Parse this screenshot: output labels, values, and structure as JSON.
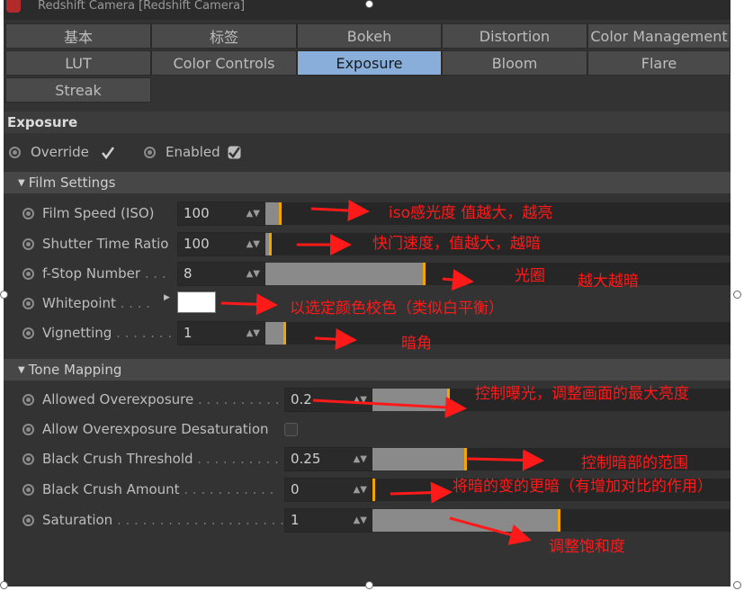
{
  "window": {
    "title": "Redshift Camera [Redshift Camera]"
  },
  "tabs": [
    {
      "label": "基本",
      "active": false
    },
    {
      "label": "标签",
      "active": false
    },
    {
      "label": "Bokeh",
      "active": false
    },
    {
      "label": "Distortion",
      "active": false
    },
    {
      "label": "Color Management",
      "active": false
    },
    {
      "label": "LUT",
      "active": false
    },
    {
      "label": "Color Controls",
      "active": false
    },
    {
      "label": "Exposure",
      "active": true
    },
    {
      "label": "Bloom",
      "active": false
    },
    {
      "label": "Flare",
      "active": false
    },
    {
      "label": "Streak",
      "active": false
    }
  ],
  "section_title": "Exposure",
  "override": {
    "label": "Override",
    "checked": true
  },
  "enabled": {
    "label": "Enabled",
    "checked": true
  },
  "film_settings": {
    "title": "Film Settings",
    "film_speed": {
      "label": "Film Speed (ISO)",
      "value": "100",
      "slider_fraction": 0.03
    },
    "shutter_time": {
      "label": "Shutter Time Ratio",
      "value": "100",
      "slider_fraction": 0.01
    },
    "fstop": {
      "label": "f-Stop Number",
      "dots": " . . .",
      "value": "8",
      "slider_fraction": 0.34
    },
    "whitepoint": {
      "label": "Whitepoint",
      "dots": " . . . .",
      "color": "#ffffff"
    },
    "vignetting": {
      "label": "Vignetting",
      "dots": " . . . . . . .",
      "value": "1",
      "slider_fraction": 0.04
    }
  },
  "tone_mapping": {
    "title": "Tone Mapping",
    "allowed_overexposure": {
      "label": "Allowed Overexposure",
      "dots": " . . . . . . . . . .",
      "value": "0.2",
      "slider_fraction": 0.21
    },
    "desaturation": {
      "label": "Allow Overexposure Desaturation",
      "checked": false
    },
    "black_crush_threshold": {
      "label": "Black Crush Threshold",
      "dots": " . . . . . . . . . .",
      "value": "0.25",
      "slider_fraction": 0.26
    },
    "black_crush_amount": {
      "label": "Black Crush Amount",
      "dots": " . . . . . . . . . . .",
      "value": "0",
      "slider_fraction": 0.0
    },
    "saturation": {
      "label": "Saturation",
      "dots": " . . . . . . . . . . . . . . . . . . . .",
      "value": "1",
      "slider_fraction": 0.52
    }
  },
  "annotations": {
    "iso": "iso感光度 值越大，越亮",
    "shutter": "快门速度，值越大，越暗",
    "fstop_a": "光圈",
    "fstop_b": "越大越暗",
    "whitepoint": "以选定颜色校色（类似白平衡）",
    "vignetting": "暗角",
    "overexposure": "控制曝光，调整画面的最大亮度",
    "threshold": "控制暗部的范围",
    "amount": "将暗的变的更暗（有增加对比的作用）",
    "saturation": "调整饱和度"
  },
  "colors": {
    "accent": "#f0a500",
    "active_tab": "#89aed9",
    "annotation": "#ff1a1a"
  }
}
